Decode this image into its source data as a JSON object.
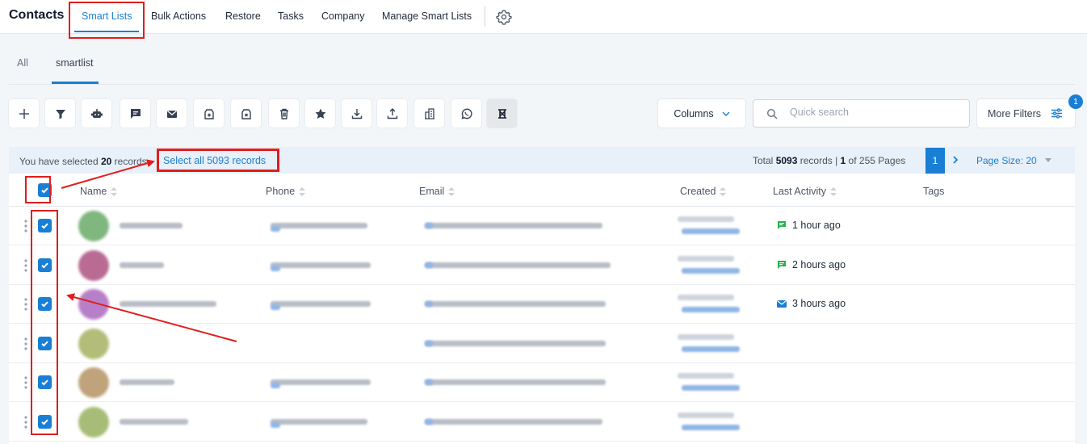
{
  "header": {
    "title": "Contacts",
    "nav": [
      "Smart Lists",
      "Bulk Actions",
      "Restore",
      "Tasks",
      "Company",
      "Manage Smart Lists"
    ],
    "active_nav": "Smart Lists"
  },
  "subtabs": {
    "items": [
      "All",
      "smartlist"
    ],
    "active": "smartlist"
  },
  "toolbar": {
    "icons": [
      "plus-icon",
      "filter-icon",
      "robot-icon",
      "message-icon",
      "email-icon",
      "add-tag-icon",
      "remove-tag-icon",
      "trash-icon",
      "star-icon",
      "download-icon",
      "upload-icon",
      "company-icon",
      "whatsapp-icon",
      "merge-icon"
    ],
    "columns_label": "Columns",
    "search_placeholder": "Quick search",
    "more_filters_label": "More Filters",
    "filter_badge_count": "1"
  },
  "selection_bar": {
    "prefix": "You have selected ",
    "selected_count": "20",
    "suffix": " records.",
    "select_all_link": "Select all 5093 records",
    "total_prefix": "Total ",
    "total_count": "5093",
    "total_mid": " records | ",
    "page_current": "1",
    "total_suffix": " of 255 Pages",
    "active_page": "1",
    "page_size_label": "Page Size: 20"
  },
  "table": {
    "columns": [
      "Name",
      "Phone",
      "Email",
      "Created",
      "Last Activity",
      "Tags"
    ],
    "rows": [
      {
        "avatar_color": "#7fb77e",
        "activity": "1 hour ago",
        "activity_icon": "message-icon"
      },
      {
        "avatar_color": "#b96b94",
        "activity": "2 hours ago",
        "activity_icon": "message-icon"
      },
      {
        "avatar_color": "#b77fc7",
        "activity": "3 hours ago",
        "activity_icon": "email-icon"
      },
      {
        "avatar_color": "#b3bd79",
        "activity": "",
        "activity_icon": ""
      },
      {
        "avatar_color": "#c0a37a",
        "activity": "",
        "activity_icon": ""
      },
      {
        "avatar_color": "#a7bd77",
        "activity": "",
        "activity_icon": ""
      }
    ]
  },
  "colors": {
    "accent": "#1a7fd4",
    "annotation_red": "#e11d1d",
    "sms_green": "#22b14c"
  }
}
